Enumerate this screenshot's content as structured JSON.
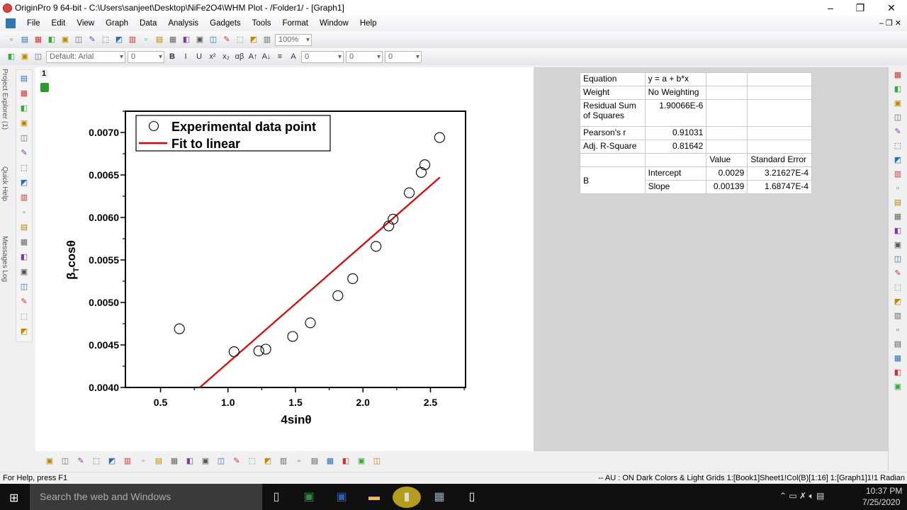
{
  "window": {
    "title": "OriginPro 9 64-bit - C:\\Users\\sanjeet\\Desktop\\NiFe2O4\\WHM Plot - /Folder1/ - [Graph1]",
    "minimize": "–",
    "restore": "❐",
    "close": "✕"
  },
  "menu": [
    "File",
    "Edit",
    "View",
    "Graph",
    "Data",
    "Analysis",
    "Gadgets",
    "Tools",
    "Format",
    "Window",
    "Help"
  ],
  "toolbar": {
    "zoom": "100%",
    "font": "Default: Arial",
    "font_size": "0",
    "line_width": "0",
    "border_width": "0"
  },
  "left_tabs": [
    "Project Explorer (1)",
    "Quick Help",
    "Messages Log"
  ],
  "layer": {
    "number": "1"
  },
  "chart_data": {
    "type": "scatter",
    "xlabel": "4sinθ",
    "ylabel": "β",
    "ylabel_sub": "T",
    "ylabel_tail": "cosθ",
    "xlim": [
      0.24,
      2.76
    ],
    "ylim": [
      0.004,
      0.00725
    ],
    "xticks": [
      "0.5",
      "1.0",
      "1.5",
      "2.0",
      "2.5"
    ],
    "yticks": [
      "0.0040",
      "0.0045",
      "0.0050",
      "0.0055",
      "0.0060",
      "0.0065",
      "0.0070"
    ],
    "legend": {
      "position": "top-left",
      "entries": [
        "Experimental data point",
        "Fit to linear"
      ]
    },
    "series": [
      {
        "name": "Experimental data point",
        "kind": "scatter",
        "x": [
          0.64,
          1.045,
          1.228,
          1.28,
          1.479,
          1.61,
          1.814,
          1.924,
          2.097,
          2.191,
          2.223,
          2.343,
          2.432,
          2.458,
          2.568
        ],
        "y": [
          0.00469,
          0.00442,
          0.00443,
          0.00445,
          0.0046,
          0.00476,
          0.00508,
          0.00528,
          0.00566,
          0.0059,
          0.00598,
          0.00629,
          0.00653,
          0.00662,
          0.00694
        ]
      },
      {
        "name": "Fit to linear",
        "kind": "line",
        "color": "#e00000",
        "intercept": 0.0029,
        "slope": 0.00139,
        "x_range": [
          0.79,
          2.57
        ]
      }
    ]
  },
  "fit_table": {
    "rows": [
      [
        "Equation",
        "y = a + b*x",
        "",
        ""
      ],
      [
        "Weight",
        "No Weighting",
        "",
        ""
      ],
      [
        "Residual Sum of Squares",
        "1.90066E-6",
        "",
        ""
      ],
      [
        "Pearson's r",
        "0.91031",
        "",
        ""
      ],
      [
        "Adj. R-Square",
        "0.81642",
        "",
        ""
      ],
      [
        "",
        "",
        "Value",
        "Standard Error"
      ]
    ],
    "param_group": "B",
    "params": [
      [
        "Intercept",
        "0.0029",
        "3.21627E-4"
      ],
      [
        "Slope",
        "0.00139",
        "1.68747E-4"
      ]
    ]
  },
  "status": {
    "help": "For Help, press F1",
    "right": "-- AU : ON  Dark Colors & Light Grids  1:[Book1]Sheet1!Col(B)[1:16]  1:[Graph1]1!1  Radian"
  },
  "taskbar": {
    "search": "Search the web and Windows",
    "time": "10:37 PM",
    "date": "7/25/2020"
  },
  "icons": {
    "tb1": [
      "new-project-icon",
      "new-folder-icon",
      "new-workbook-icon",
      "new-excel-icon",
      "new-graph-icon",
      "new-matrix-icon",
      "new-function-icon",
      "new-layout-icon",
      "new-notes-icon",
      "new-function-plot-icon",
      "open-icon",
      "open-template-icon",
      "open-excel-icon",
      "save-icon",
      "save-template-icon",
      "import-ascii-icon",
      "import-multiple-icon",
      "import-wizard-icon",
      "duplicate-icon",
      "recalculate-icon"
    ],
    "tb2": [
      "cut-icon",
      "copy-icon",
      "paste-icon"
    ],
    "tools": [
      "pointer-icon",
      "zoom-in-icon",
      "zoom-out-icon",
      "data-reader-icon",
      "screen-reader-icon",
      "data-selector-icon",
      "draw-data-icon",
      "region-mask-icon",
      "scale-icon",
      "text-tool-icon",
      "arrow-tool-icon",
      "line-tool-icon",
      "rectangle-tool-icon",
      "pan-icon",
      "region-icon",
      "data-display-icon",
      "add-layer-icon",
      "layer-stack-icon"
    ],
    "right": [
      "rescale-icon",
      "layer-icon",
      "merge-icon",
      "arrange-icon",
      "extract-icon",
      "axis-icon",
      "frame-icon",
      "legend-icon",
      "speed-icon",
      "date-icon",
      "timestamp-icon",
      "table-icon",
      "scale-bar-icon",
      "refresh-icon",
      "grid-icon",
      "object-icon",
      "shape-icon",
      "shape2-icon",
      "shape3-icon",
      "shape4-icon",
      "shape5-icon",
      "shape6-icon",
      "shape7-icon"
    ],
    "bottom": [
      "line-plot-icon",
      "scatter-plot-icon",
      "line-symbol-icon",
      "column-plot-icon",
      "image-plot-icon",
      "error-bar-icon",
      "area-plot-icon",
      "polar-plot-icon",
      "stock-plot-icon",
      "template-icon",
      "3d-bar-icon",
      "3d-surface-icon",
      "3d-scatter-icon",
      "3d-wire-icon",
      "contour-icon",
      "ternary-icon",
      "profile-icon",
      "vector-icon",
      "bubble-icon",
      "stack-icon",
      "color-map-icon",
      "multi-axis-icon"
    ]
  }
}
